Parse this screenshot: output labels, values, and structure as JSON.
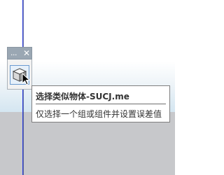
{
  "toolbar": {
    "dots_label": "...",
    "close_label": "✕",
    "tool_icon": "component-cube-icon"
  },
  "tooltip": {
    "title": "选择类似物体-SUCJ.me",
    "description": "仅选择一个组或组件并设置误差值"
  },
  "colors": {
    "axis_blue": "#2f3fd9",
    "ground": "#c7c8cb",
    "toolbar_titlebar": "#9aa7b3",
    "tool_highlight": "#e6f0fa",
    "tool_highlight_border": "#6b9bd1"
  }
}
